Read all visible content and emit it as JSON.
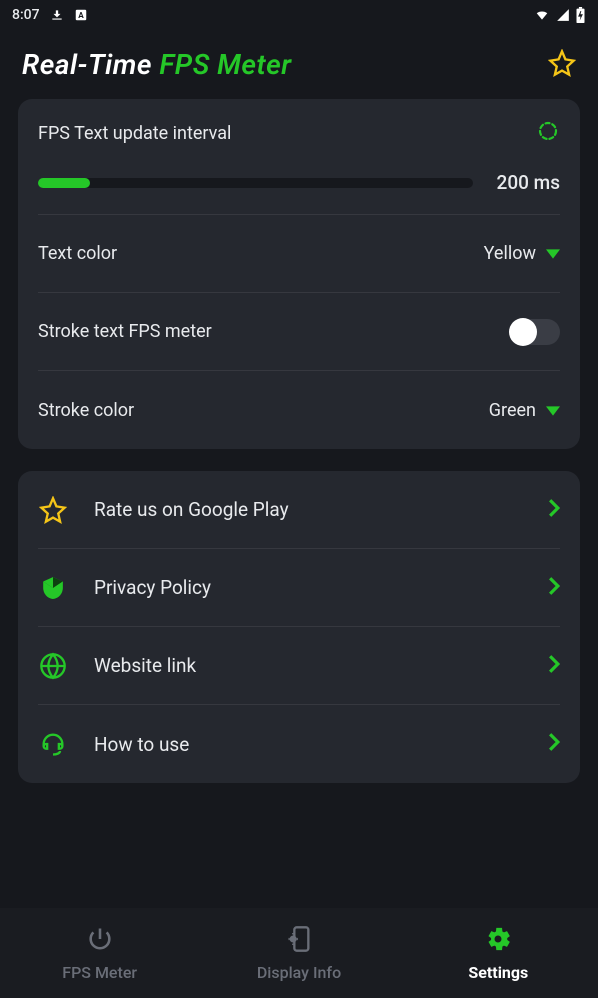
{
  "status": {
    "time": "8:07"
  },
  "header": {
    "title_part1": "Real-Time ",
    "title_part2": "FPS Meter"
  },
  "settings": {
    "update_interval": {
      "label": "FPS Text update interval",
      "value": "200 ms"
    },
    "text_color": {
      "label": "Text color",
      "value": "Yellow"
    },
    "stroke_toggle": {
      "label": "Stroke text FPS meter",
      "enabled": false
    },
    "stroke_color": {
      "label": "Stroke color",
      "value": "Green"
    }
  },
  "links": {
    "rate": "Rate us on Google Play",
    "privacy": "Privacy Policy",
    "website": "Website link",
    "howto": "How to use"
  },
  "nav": {
    "fps": "FPS Meter",
    "display": "Display Info",
    "settings": "Settings"
  }
}
